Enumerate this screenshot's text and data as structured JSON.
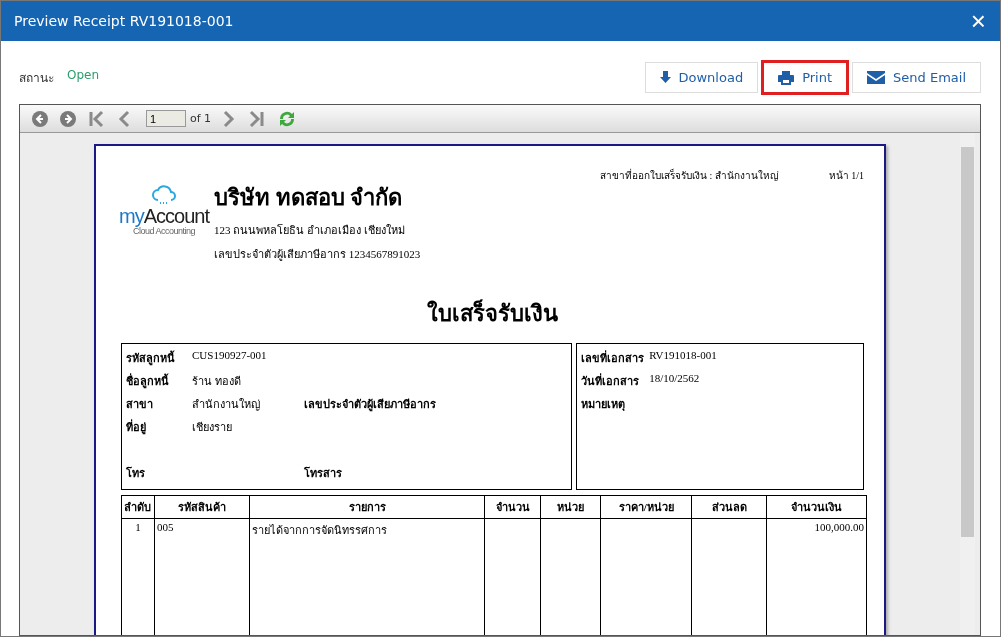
{
  "window": {
    "title": "Preview Receipt RV191018-001",
    "close": "×"
  },
  "status": {
    "label": "สถานะ",
    "value": "Open"
  },
  "buttons": [
    {
      "label": "Download",
      "kind": "download",
      "highlighted": false
    },
    {
      "label": "Print",
      "kind": "print",
      "highlighted": true
    },
    {
      "label": "Send Email",
      "kind": "email",
      "highlighted": false
    }
  ],
  "viewer": {
    "page_input": "1",
    "page_count": "of 1"
  },
  "document": {
    "logo": {
      "brand_first": "my",
      "brand_second": "Account",
      "tagline": "Cloud Accounting"
    },
    "company": {
      "name": "บริษัท ทดสอบ จำกัด",
      "address": "123 ถนนพหลโยธิน อำเภอเมือง เชียงใหม่",
      "tax_id": "เลขประจำตัวผู้เสียภาษีอากร 1234567891023"
    },
    "branch_line": "สาขาที่ออกใบเสร็จรับเงิน : สำนักงานใหญ่",
    "page_label": "หน้า 1/1",
    "title": "ใบเสร็จรับเงิน",
    "customer_fields": [
      {
        "label": "รหัสลูกหนี้",
        "value": "CUS190927-001"
      },
      {
        "label": "ชื่อลูกหนี้",
        "value": "ร้าน ทองดี"
      },
      {
        "label": "สาขา",
        "value": "สำนักงานใหญ่",
        "extra_label": "เลขประจำตัวผู้เสียภาษีอากร"
      },
      {
        "label": "ที่อยู่",
        "value": "เชียงราย"
      }
    ],
    "contact": {
      "phone_label": "โทร",
      "fax_label": "โทรสาร"
    },
    "doc_fields": [
      {
        "label": "เลขที่เอกสาร",
        "value": "RV191018-001"
      },
      {
        "label": "วันที่เอกสาร",
        "value": "18/10/2562"
      },
      {
        "label": "หมายเหตุ"
      }
    ],
    "table": {
      "columns": [
        "ลำดับ",
        "รหัสสินค้า",
        "รายการ",
        "จำนวน",
        "หน่วย",
        "ราคา/หน่วย",
        "ส่วนลด",
        "จำนวนเงิน"
      ],
      "rows": [
        [
          "1",
          "005",
          "รายได้จากการจัดนิทรรศการ",
          "",
          "",
          "",
          "",
          "100,000.00"
        ]
      ]
    }
  }
}
